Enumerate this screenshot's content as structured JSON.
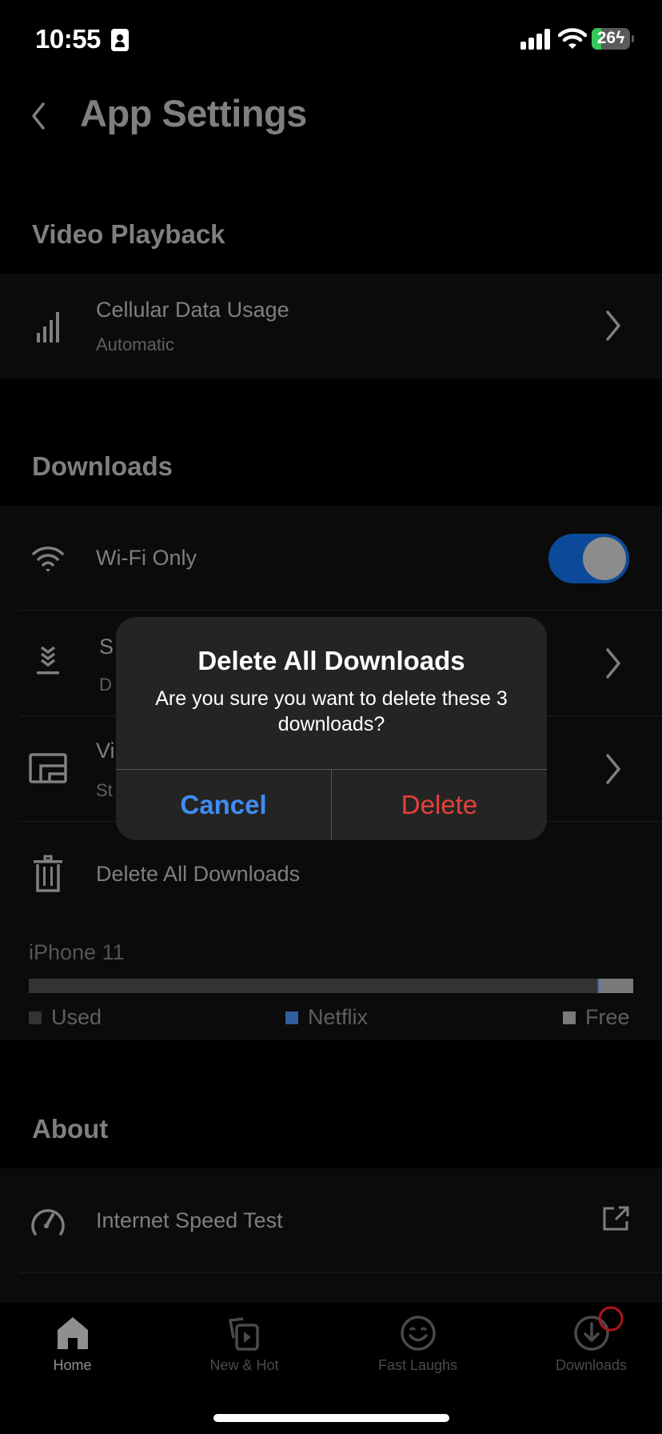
{
  "status_bar": {
    "time": "10:55",
    "battery_percent": 26,
    "battery_label": "26",
    "charging": true,
    "battery_fill_color": "#34c759"
  },
  "header": {
    "title": "App Settings",
    "back_icon": "chevron-left-icon"
  },
  "sections": {
    "video_playback": {
      "title": "Video Playback",
      "items": [
        {
          "label": "Cellular Data Usage",
          "sublabel": "Automatic",
          "icon": "signal-bars-icon",
          "accessory": "chevron-right-icon"
        }
      ]
    },
    "downloads": {
      "title": "Downloads",
      "items": [
        {
          "label": "Wi-Fi Only",
          "icon": "wifi-icon",
          "accessory": "toggle",
          "toggle_on": true
        },
        {
          "label": "S",
          "sublabel": "D",
          "icon": "smart-downloads-icon",
          "accessory": "chevron-right-icon"
        },
        {
          "label": "Vi",
          "sublabel": "St",
          "icon": "video-quality-icon",
          "accessory": "chevron-right-icon"
        },
        {
          "label": "Delete All Downloads",
          "icon": "trash-icon"
        }
      ],
      "storage": {
        "device": "iPhone 11",
        "used_fraction": 0.94,
        "netflix_fraction": 0.003,
        "free_fraction": 0.057,
        "legend": [
          {
            "label": "Used",
            "color": "#333333"
          },
          {
            "label": "Netflix",
            "color": "#2f5f9e"
          },
          {
            "label": "Free",
            "color": "#7a7a7a"
          }
        ]
      }
    },
    "about": {
      "title": "About",
      "items": [
        {
          "label": "Internet Speed Test",
          "icon": "speedometer-icon",
          "accessory": "external-link-icon"
        }
      ]
    }
  },
  "alert": {
    "title": "Delete All Downloads",
    "message": "Are you sure you want to delete these 3 downloads?",
    "cancel_label": "Cancel",
    "delete_label": "Delete",
    "cancel_color": "#3f8cf3",
    "delete_color": "#e6413a"
  },
  "tab_bar": {
    "active": "Home",
    "tabs": [
      {
        "label": "Home",
        "icon": "home-icon"
      },
      {
        "label": "New & Hot",
        "icon": "new-hot-icon"
      },
      {
        "label": "Fast Laughs",
        "icon": "smiley-icon"
      },
      {
        "label": "Downloads",
        "icon": "download-icon",
        "badge": true
      }
    ]
  }
}
